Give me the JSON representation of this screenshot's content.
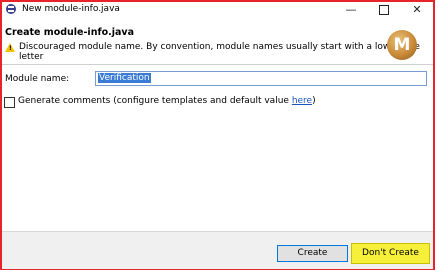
{
  "window": {
    "title": "New module-info.java",
    "minimize": "—",
    "close": "✕"
  },
  "header": {
    "title": "Create module-info.java",
    "message": "Discouraged module name. By convention, module names usually start with a lowercase letter",
    "logo_letter": "M"
  },
  "form": {
    "module_name_label": "Module name:",
    "module_name_value": "Verification",
    "generate_comments_label": "Generate comments (configure templates and default value ",
    "generate_comments_link": "here",
    "generate_comments_suffix": ")",
    "generate_comments_checked": false
  },
  "footer": {
    "create_label": "Create",
    "dont_create_label": "Don't Create"
  },
  "colors": {
    "frame_border": "#e8242b",
    "highlight": "#f7f03a",
    "selection": "#3a7bd5"
  }
}
